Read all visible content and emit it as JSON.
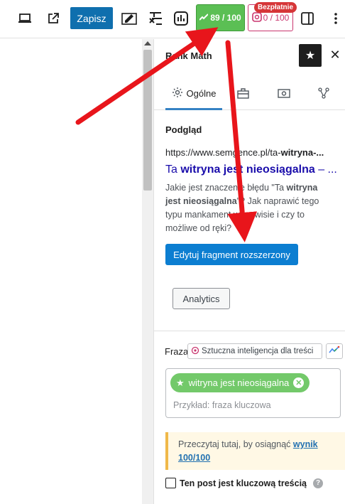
{
  "toolbar": {
    "save_label": "Zapisz",
    "score_label": "89 / 100",
    "ai_score_label": "0 / 100",
    "free_badge": "Bezpłatnie"
  },
  "sidebar": {
    "title": "Rank Math",
    "tabs": [
      {
        "label": "Ogólne",
        "icon": "gear-icon",
        "active": true
      },
      {
        "label": "",
        "icon": "toolbox-icon",
        "active": false
      },
      {
        "label": "",
        "icon": "media-icon",
        "active": false
      },
      {
        "label": "",
        "icon": "schema-icon",
        "active": false
      }
    ],
    "preview": {
      "heading": "Podgląd",
      "url_prefix": "https://www.semgence.pl/ta-",
      "url_bold": "witryna-...",
      "title_prefix": "Ta ",
      "title_bold": "witryna jest nieosiągalna",
      "title_suffix": " – ...",
      "desc_before": "Jakie jest znaczenie błędu \"Ta ",
      "desc_bold": "witryna jest nieosiągalna",
      "desc_after": "\"? Jak naprawić tego typu mankament w serwisie i czy to możliwe od ręki?"
    },
    "edit_snippet_label": "Edytuj fragment rozszerzony",
    "analytics_label": "Analytics",
    "focus": {
      "label": "Fraza",
      "ai_label": "Sztuczna inteligencja dla treści",
      "keyword": "witryna jest nieosiągalna",
      "placeholder": "Przykład: fraza kluczowa"
    },
    "notice": {
      "text": "Przeczytaj tutaj, by osiągnąć ",
      "link": "wynik 100/100"
    },
    "pillar_label": "Ten post jest kluczową treścią"
  },
  "colors": {
    "primary": "#0f6fae",
    "score_green": "#5bbf54",
    "keyword_green": "#73c96a",
    "ai_pink": "#c9356e",
    "arrow_red": "#e8151b"
  }
}
